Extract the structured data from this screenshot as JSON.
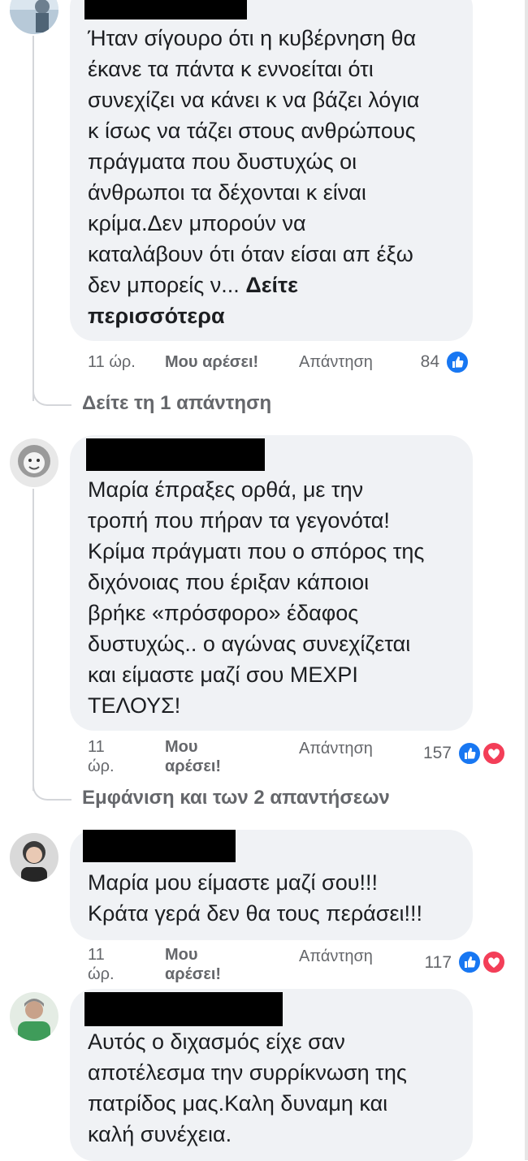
{
  "comments": [
    {
      "text_lines": [
        "Ήταν σίγουρο ότι η κυβέρνηση θα",
        "έκανε τα πάντα κ εννοείται ότι",
        "συνεχίζει να κάνει κ να βάζει λόγια",
        "κ ίσως να τάζει στους ανθρώπους",
        "πράγματα που δυστυχώς οι",
        "άνθρωποι τα δέχονται κ είναι",
        "κρίμα.Δεν μπορούν να",
        "καταλάβουν ότι όταν είσαι απ έξω",
        "δεν μπορείς ν..."
      ],
      "see_more": "Δείτε περισσότερα",
      "see_more_line1": "Δείτε",
      "see_more_line2": "περισσότερα",
      "time": "11 ώρ.",
      "like": "Μου αρέσει!",
      "reply": "Απάντηση",
      "reaction_count": "84",
      "reactions": [
        "like-icon"
      ],
      "replies_link": "Δείτε τη 1 απάντηση"
    },
    {
      "text_lines": [
        "Μαρία έπραξες ορθά, με την",
        "τροπή που πήραν τα γεγονότα!",
        "Κρίμα πράγματι που ο σπόρος της",
        "διχόνοιας που έριξαν κάποιοι",
        "βρήκε «πρόσφορο» έδαφος",
        "δυστυχώς.. ο αγώνας συνεχίζεται",
        "και είμαστε μαζί σου ΜΕΧΡΙ",
        "ΤΕΛΟΥΣ!"
      ],
      "time_line1": "11",
      "time_line2": "ώρ.",
      "like_line1": "Μου",
      "like_line2": "αρέσει!",
      "reply": "Απάντηση",
      "reaction_count": "157",
      "reactions": [
        "like-icon",
        "love-icon"
      ],
      "replies_link": "Εμφάνιση και των 2 απαντήσεων"
    },
    {
      "text_lines": [
        "Μαρία μου είμαστε μαζί σου!!!",
        "Κράτα γερά δεν θα τους περάσει!!!"
      ],
      "time_line1": "11",
      "time_line2": "ώρ.",
      "like_line1": "Μου",
      "like_line2": "αρέσει!",
      "reply": "Απάντηση",
      "reaction_count": "117",
      "reactions": [
        "like-icon",
        "love-icon"
      ]
    },
    {
      "text_lines": [
        "Αυτός ο διχασμός είχε σαν",
        "αποτέλεσμα την συρρίκνωση της",
        "πατρίδος μας.Καλη δυναμη και",
        "καλή συνέχεια."
      ]
    }
  ],
  "colors": {
    "bubble": "#f0f2f5",
    "meta_text": "#65676b",
    "like_blue": "#1877f2",
    "love_red": "#f33e58",
    "redaction": "#000000"
  }
}
